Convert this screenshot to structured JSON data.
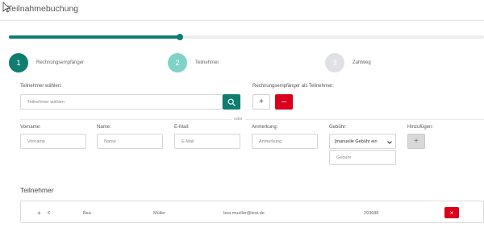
{
  "page": {
    "title": "Teilnahmebuchung"
  },
  "progress": {
    "value_percent": 36
  },
  "steps": [
    {
      "number": "1",
      "label": "Rechnungsempfänger",
      "state": "done",
      "color": "#0f7d70"
    },
    {
      "number": "2",
      "label": "Teilnehmer",
      "state": "active",
      "color": "#7fd3c6"
    },
    {
      "number": "3",
      "label": "Zahlweg",
      "state": "pending",
      "color": "#dfe1e6"
    }
  ],
  "participant_select": {
    "label": "Teilnehmer wählen:",
    "placeholder": "Teilnehmer wählen",
    "search_icon": "search-icon"
  },
  "invoice_recipient": {
    "label": "Rechnungsempfänger als Teilnehmer:",
    "add_symbol": "+",
    "remove_symbol": "–"
  },
  "separator": {
    "text": "oder"
  },
  "form": {
    "first_name": {
      "label": "Vorname:",
      "placeholder": "Vorname"
    },
    "last_name": {
      "label": "Name:",
      "placeholder": "Name"
    },
    "email": {
      "label": "E-Mail:",
      "placeholder": "E-Mail"
    },
    "note": {
      "label": "Anmerkung:",
      "placeholder": "Anmerkung"
    },
    "fee": {
      "label": "Gebühr:",
      "selected": "[manuelle Gebühr ein",
      "placeholder": "Gebühr"
    },
    "add": {
      "label": "Hinzufügen:",
      "symbol": "+"
    }
  },
  "participants": {
    "title": "Teilnehmer",
    "rows": [
      {
        "plus": "+",
        "currency": "€",
        "first_name": "Bea",
        "last_name": "Müller",
        "email": "bea.mueller@test.de",
        "number": "293688",
        "remove_symbol": "×"
      }
    ]
  },
  "colors": {
    "accent": "#0f7d70",
    "danger": "#d9001b",
    "step_active": "#7fd3c6",
    "step_pending": "#dfe1e6"
  }
}
